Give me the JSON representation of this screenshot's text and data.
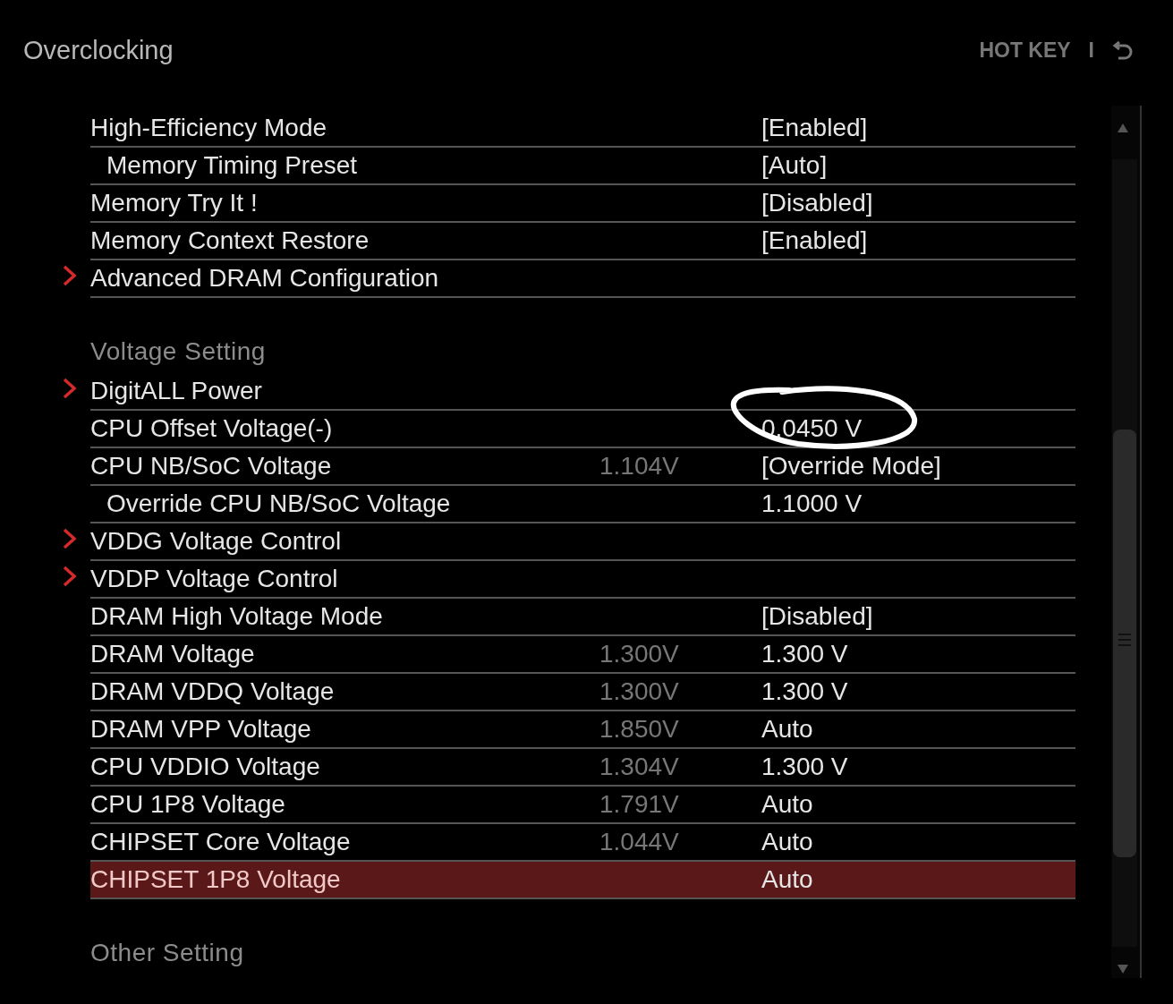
{
  "header": {
    "title": "Overclocking",
    "hotkey": "HOT KEY",
    "separator": "I"
  },
  "items": [
    {
      "kind": "setting",
      "label": "High-Efficiency Mode",
      "value": "[Enabled]",
      "selected": false,
      "children": [
        {
          "kind": "setting",
          "label": "Memory Timing Preset",
          "value": "[Auto]",
          "selected": false
        }
      ]
    },
    {
      "kind": "setting",
      "label": "Memory Try It !",
      "value": "[Disabled]",
      "selected": false
    },
    {
      "kind": "setting",
      "label": "Memory Context Restore",
      "value": "[Enabled]",
      "selected": false
    },
    {
      "kind": "submenu",
      "label": "Advanced DRAM Configuration",
      "selected": false
    },
    {
      "kind": "section",
      "label": "Voltage Setting"
    },
    {
      "kind": "submenu",
      "label": "DigitALL Power",
      "selected": false
    },
    {
      "kind": "setting",
      "label": "CPU Offset Voltage(-)",
      "value": "0.0450 V",
      "selected": false
    },
    {
      "kind": "setting",
      "label": "CPU NB/SoC Voltage",
      "reading": "1.104V",
      "value": "[Override Mode]",
      "selected": false,
      "children": [
        {
          "kind": "setting",
          "label": "Override CPU NB/SoC Voltage",
          "value": "1.1000 V",
          "selected": false
        }
      ]
    },
    {
      "kind": "submenu",
      "label": "VDDG Voltage Control",
      "selected": false
    },
    {
      "kind": "submenu",
      "label": "VDDP Voltage Control",
      "selected": false
    },
    {
      "kind": "setting",
      "label": "DRAM High Voltage Mode",
      "value": "[Disabled]",
      "selected": false
    },
    {
      "kind": "setting",
      "label": "DRAM Voltage",
      "reading": "1.300V",
      "value": "1.300 V",
      "selected": false
    },
    {
      "kind": "setting",
      "label": "DRAM VDDQ Voltage",
      "reading": "1.300V",
      "value": "1.300 V",
      "selected": false
    },
    {
      "kind": "setting",
      "label": "DRAM VPP Voltage",
      "reading": "1.850V",
      "value": "Auto",
      "selected": false
    },
    {
      "kind": "setting",
      "label": "CPU VDDIO Voltage",
      "reading": "1.304V",
      "value": "1.300 V",
      "selected": false
    },
    {
      "kind": "setting",
      "label": "CPU 1P8 Voltage",
      "reading": "1.791V",
      "value": "Auto",
      "selected": false
    },
    {
      "kind": "setting",
      "label": "CHIPSET Core Voltage",
      "reading": "1.044V",
      "value": "Auto",
      "selected": false
    },
    {
      "kind": "setting",
      "label": "CHIPSET 1P8 Voltage",
      "value": "Auto",
      "selected": true
    },
    {
      "kind": "section",
      "label": "Other Setting"
    }
  ],
  "annotations": [
    {
      "kind": "circle"
    }
  ]
}
